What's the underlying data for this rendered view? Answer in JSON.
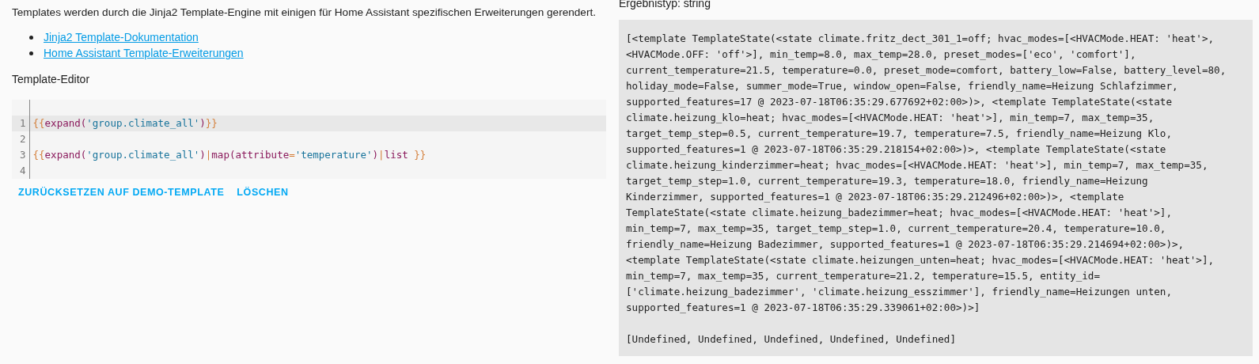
{
  "intro": "Templates werden durch die Jinja2 Template-Engine mit einigen für Home Assistant spezifischen Erweiterungen gerendert.",
  "links": [
    {
      "label": "Jinja2 Template-Dokumentation"
    },
    {
      "label": "Home Assistant Template-Erweiterungen"
    }
  ],
  "editor": {
    "title": "Template-Editor",
    "lines": [
      {
        "number": "1",
        "active": true,
        "tokens": [
          {
            "kind": "brace",
            "text": "{{"
          },
          {
            "kind": "name",
            "text": "expand("
          },
          {
            "kind": "string",
            "text": "'group.climate_all'"
          },
          {
            "kind": "name",
            "text": ")"
          },
          {
            "kind": "brace",
            "text": "}}"
          }
        ]
      },
      {
        "number": "2",
        "active": false
      },
      {
        "number": "3",
        "active": false,
        "tokens": [
          {
            "kind": "brace",
            "text": "{{"
          },
          {
            "kind": "name",
            "text": "expand("
          },
          {
            "kind": "string",
            "text": "'group.climate_all'"
          },
          {
            "kind": "name",
            "text": ")"
          },
          {
            "kind": "brace",
            "text": "|"
          },
          {
            "kind": "name",
            "text": "map(attribute"
          },
          {
            "kind": "brace",
            "text": "="
          },
          {
            "kind": "string",
            "text": "'temperature'"
          },
          {
            "kind": "name",
            "text": ")"
          },
          {
            "kind": "brace",
            "text": "|"
          },
          {
            "kind": "name",
            "text": "list "
          },
          {
            "kind": "brace",
            "text": "}}"
          }
        ]
      },
      {
        "number": "4",
        "active": false
      }
    ]
  },
  "buttons": [
    "ZURÜCKSETZEN AUF DEMO-TEMPLATE",
    "LÖSCHEN"
  ],
  "result": {
    "type_label": "Ergebnistyp: string",
    "paragraphs": [
      [
        "[<template TemplateState(<state climate.fritz_dect_301_1=off; hvac_modes=[<HVACMode.HEAT: 'heat'>,",
        "<HVACMode.OFF: 'off'>], min_temp=8.0, max_temp=28.0, preset_modes=['eco', 'comfort'],",
        "current_temperature=21.5, temperature=0.0, preset_mode=comfort, battery_low=False, battery_level=80,",
        "holiday_mode=False, summer_mode=True, window_open=False, friendly_name=Heizung Schlafzimmer,",
        "supported_features=17 @ 2023-07-18T06:35:29.677692+02:00>)>, <template TemplateState(<state",
        "climate.heizung_klo=heat; hvac_modes=[<HVACMode.HEAT: 'heat'>], min_temp=7, max_temp=35,",
        "target_temp_step=0.5, current_temperature=19.7, temperature=7.5, friendly_name=Heizung Klo,",
        "supported_features=1 @ 2023-07-18T06:35:29.218154+02:00>)>, <template TemplateState(<state",
        "climate.heizung_kinderzimmer=heat; hvac_modes=[<HVACMode.HEAT: 'heat'>], min_temp=7, max_temp=35,",
        "target_temp_step=1.0, current_temperature=19.3, temperature=18.0, friendly_name=Heizung",
        "Kinderzimmer, supported_features=1 @ 2023-07-18T06:35:29.212496+02:00>)>, <template",
        "TemplateState(<state climate.heizung_badezimmer=heat; hvac_modes=[<HVACMode.HEAT: 'heat'>],",
        "min_temp=7, max_temp=35, target_temp_step=1.0, current_temperature=20.4, temperature=10.0,",
        "friendly_name=Heizung Badezimmer, supported_features=1 @ 2023-07-18T06:35:29.214694+02:00>)>,",
        "<template TemplateState(<state climate.heizungen_unten=heat; hvac_modes=[<HVACMode.HEAT: 'heat'>],",
        "min_temp=7, max_temp=35, current_temperature=21.2, temperature=15.5, entity_id=",
        "['climate.heizung_badezimmer', 'climate.heizung_esszimmer'], friendly_name=Heizungen unten,",
        "supported_features=1 @ 2023-07-18T06:35:29.339061+02:00>)>]"
      ],
      [
        "[Undefined, Undefined, Undefined, Undefined, Undefined]"
      ]
    ]
  }
}
